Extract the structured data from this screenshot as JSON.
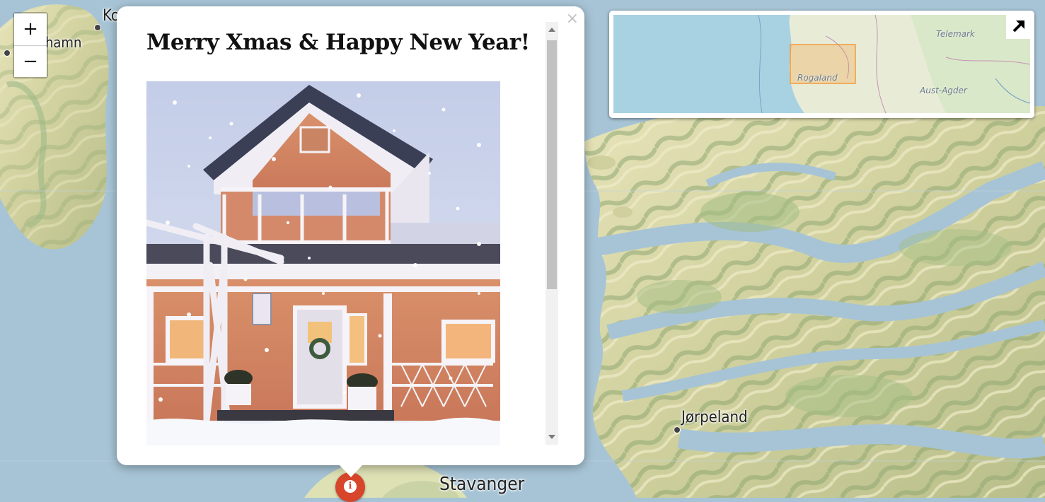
{
  "map": {
    "places": [
      {
        "name": "Ko",
        "id": "ko"
      },
      {
        "name": "hamn",
        "id": "hamn"
      },
      {
        "name": "Jørpeland",
        "id": "jorpeland"
      },
      {
        "name": "Stavanger",
        "id": "stavanger"
      }
    ],
    "colors": {
      "water": "#a7c4d6",
      "land": "#d6dca9",
      "forest": "#a3be84",
      "hill": "#c7c28e"
    }
  },
  "zoom": {
    "in_label": "+",
    "out_label": "−"
  },
  "popup": {
    "title": "Merry Xmas & Happy New Year!",
    "close_label": "×",
    "image": {
      "subject": "snow-covered-house-with-christmas-lights"
    }
  },
  "marker": {
    "icon": "info-icon",
    "glyph": "i",
    "color": "#d7452b"
  },
  "minimap": {
    "labels": {
      "rogaland": "Rogaland",
      "telemark": "Telemark",
      "aust_agder": "Aust-Agder"
    },
    "toggle_icon": "arrow-up-right-icon",
    "highlight_color": "#f39c3c"
  }
}
